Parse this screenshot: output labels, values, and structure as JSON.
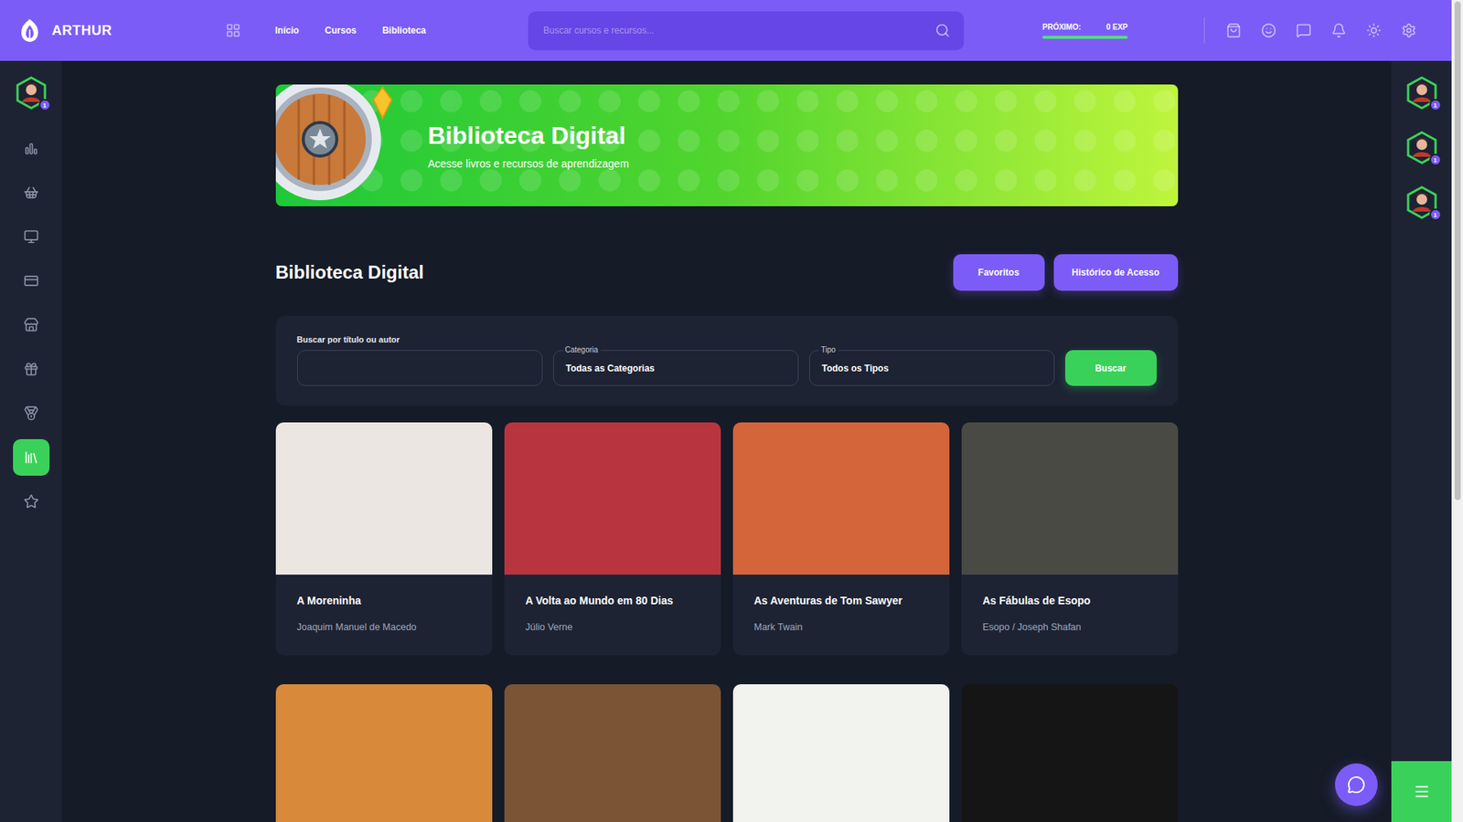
{
  "topbar": {
    "logo": "ARTHUR",
    "nav": [
      "Início",
      "Cursos",
      "Biblioteca"
    ],
    "search": {
      "placeholder": "Buscar cursos e recursos..."
    },
    "progress": {
      "label": "PRÓXIMO:",
      "reading": "0 EXP",
      "level": 1
    }
  },
  "left_sidebar": {
    "avatar_badge": "1",
    "items": [
      {
        "selected": false
      },
      {
        "selected": false
      },
      {
        "selected": false
      },
      {
        "selected": false
      },
      {
        "selected": false
      },
      {
        "selected": false
      },
      {
        "selected": false
      },
      {
        "selected": true
      },
      {
        "selected": false
      }
    ]
  },
  "right_sidebar": {
    "avatars": [
      {
        "badge": "1"
      },
      {
        "badge": "1"
      },
      {
        "badge": "1"
      }
    ]
  },
  "banner": {
    "title": "Biblioteca Digital",
    "subtitle": "Acesse livros e recursos de aprendizagem"
  },
  "section": {
    "title": "Biblioteca Digital",
    "buttons": [
      "Favoritos",
      "Histórico de Acesso"
    ]
  },
  "filters": {
    "search_label": "Buscar por título ou autor",
    "search_value": "",
    "category": {
      "label": "Categoria",
      "value": "Todas as Categorias"
    },
    "type": {
      "label": "Tipo",
      "value": "Todos os Tipos"
    },
    "submit": "Buscar"
  },
  "books": [
    {
      "title": "A Moreninha",
      "author": "Joaquim Manuel de Macedo",
      "color": "#ece6e2"
    },
    {
      "title": "A Volta ao Mundo em 80 Dias",
      "author": "Júlio Verne",
      "color": "#b8353f"
    },
    {
      "title": "As Aventuras de Tom Sawyer",
      "author": "Mark Twain",
      "color": "#d4653a"
    },
    {
      "title": "As Fábulas de Esopo",
      "author": "Esopo / Joseph Shafan",
      "color": "#4a4a44"
    }
  ],
  "more_books": [
    {
      "color": "#d88a3a"
    },
    {
      "color": "#7a5434"
    },
    {
      "color": "#f2f2ee"
    },
    {
      "color": "#151515"
    }
  ]
}
